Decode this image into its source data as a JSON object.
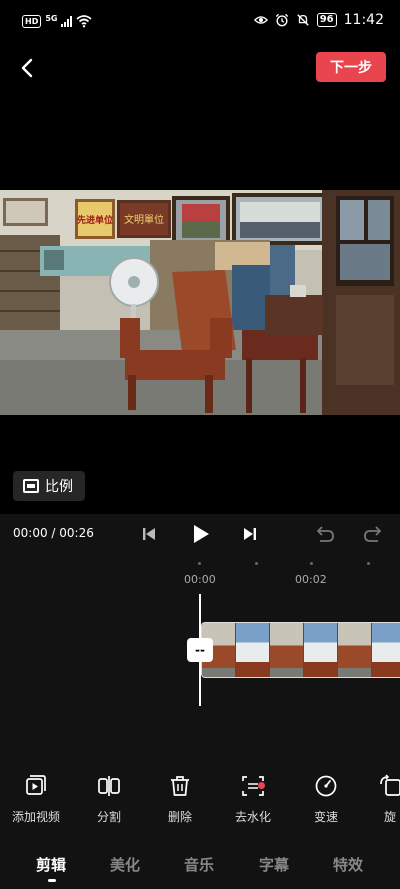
{
  "status_bar": {
    "hd": "HD",
    "network": "5G",
    "battery": "96",
    "time": "11:42"
  },
  "header": {
    "next_label": "下一步"
  },
  "preview": {
    "signs": [
      "先进单位",
      "文明單位"
    ]
  },
  "ratio_button": {
    "label": "比例"
  },
  "playback": {
    "timecode": "00:00 / 00:26"
  },
  "timeline": {
    "ticks": [
      "00:00",
      "00:02"
    ],
    "playhead_handle": "--"
  },
  "toolbar": {
    "items": [
      {
        "label": "添加视频",
        "icon": "add-video-icon"
      },
      {
        "label": "分割",
        "icon": "split-icon"
      },
      {
        "label": "删除",
        "icon": "delete-icon"
      },
      {
        "label": "去水化",
        "icon": "remove-watermark-icon"
      },
      {
        "label": "变速",
        "icon": "speed-icon"
      },
      {
        "label": "旋",
        "icon": "rotate-icon"
      }
    ]
  },
  "tabs": {
    "items": [
      "剪辑",
      "美化",
      "音乐",
      "字幕",
      "特效"
    ],
    "active": "剪辑"
  },
  "colors": {
    "accent": "#e8454f",
    "background": "#000000",
    "panel": "#121212"
  }
}
